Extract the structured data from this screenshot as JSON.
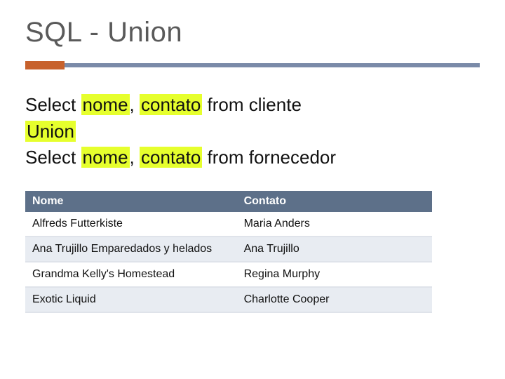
{
  "title": "SQL - Union",
  "sql": {
    "select1_a": "Select ",
    "select1_hl1": "nome",
    "select1_b": ", ",
    "select1_hl2": "contato",
    "select1_c": " from cliente",
    "union_hl": "Union",
    "select2_a": "Select ",
    "select2_hl1": "nome",
    "select2_b": ", ",
    "select2_hl2": "contato",
    "select2_c": " from fornecedor"
  },
  "table": {
    "headers": {
      "col0": "Nome",
      "col1": "Contato"
    },
    "rows": [
      {
        "col0": "Alfreds Futterkiste",
        "col1": "Maria Anders"
      },
      {
        "col0": "Ana Trujillo Emparedados y helados",
        "col1": "Ana Trujillo"
      },
      {
        "col0": "Grandma Kelly's Homestead",
        "col1": "Regina Murphy"
      },
      {
        "col0": "Exotic Liquid",
        "col1": "Charlotte Cooper"
      }
    ]
  }
}
